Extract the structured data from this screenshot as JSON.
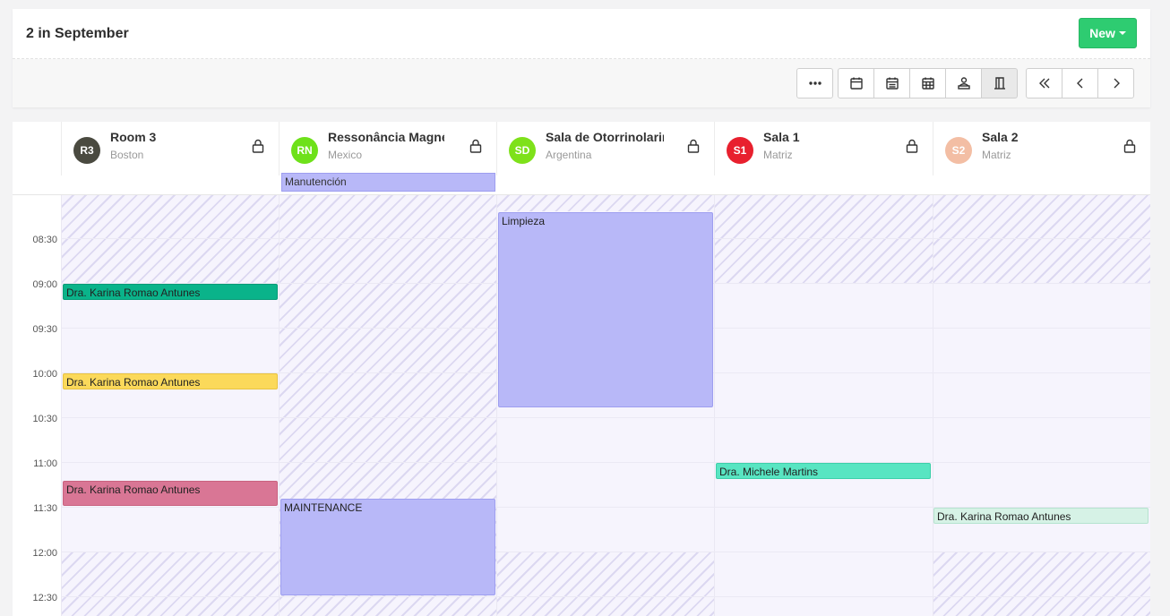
{
  "header": {
    "title": "2 in September",
    "new_label": "New"
  },
  "toolbar": {
    "more_icon": "more-horizontal-icon",
    "views": [
      "calendar-day-icon",
      "calendar-week-icon",
      "calendar-month-icon",
      "user-resource-icon",
      "room-door-icon"
    ],
    "nav": [
      "double-chevron-left-icon",
      "chevron-left-icon",
      "chevron-right-icon"
    ]
  },
  "resources": [
    {
      "initials": "R3",
      "name": "Room 3",
      "location": "Boston",
      "color": "#4a4a40"
    },
    {
      "initials": "RN",
      "name": "Ressonância Magnética",
      "location": "Mexico",
      "color": "#6ee11a"
    },
    {
      "initials": "SD",
      "name": "Sala de Otorrinolaringologia",
      "location": "Argentina",
      "color": "#7ee11a"
    },
    {
      "initials": "S1",
      "name": "Sala 1",
      "location": "Matriz",
      "color": "#e8202e"
    },
    {
      "initials": "S2",
      "name": "Sala 2",
      "location": "Matriz",
      "color": "#f3bea4"
    }
  ],
  "all_day_events": [
    {
      "title": "Manutención"
    }
  ],
  "time_labels": [
    "08:30",
    "09:00",
    "09:30",
    "10:00",
    "10:30",
    "11:00",
    "11:30",
    "12:00",
    "12:30"
  ],
  "events": [
    {
      "title": "Dra. Karina Romao Antunes",
      "color": "#0ab38a"
    },
    {
      "title": "Dra. Karina Romao Antunes",
      "color": "#fbd95a"
    },
    {
      "title": "Dra. Karina Romao Antunes",
      "color": "#d97695"
    },
    {
      "title": "MAINTENANCE",
      "color": "#b8b8f8"
    },
    {
      "title": "Limpieza",
      "color": "#b8b8f8"
    },
    {
      "title": "Dra. Michele Martins",
      "color": "#58e5c2"
    },
    {
      "title": "Dra. Karina Romao Antunes",
      "color": "#d6f2e6"
    }
  ]
}
